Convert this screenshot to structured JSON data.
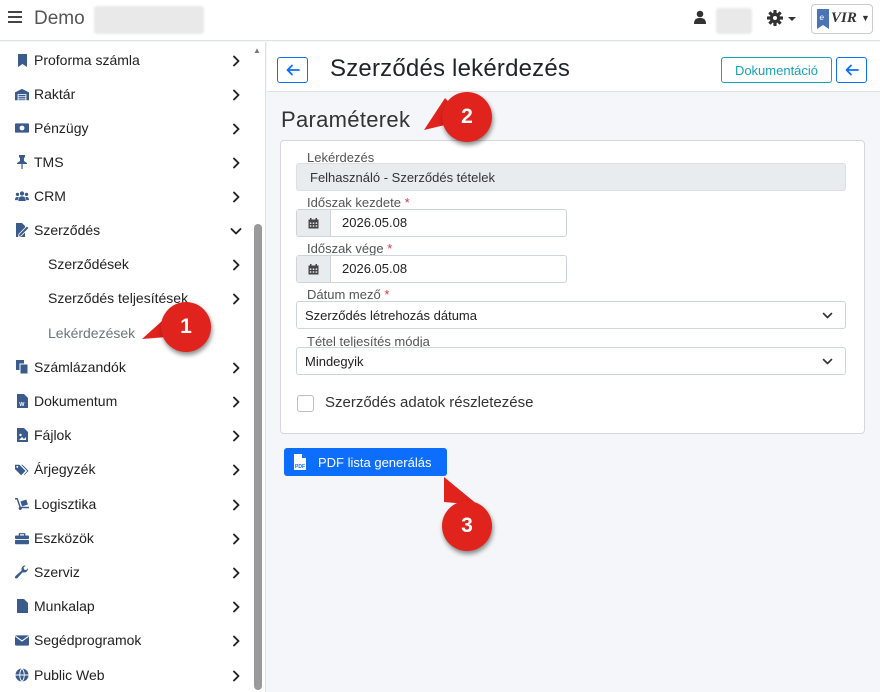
{
  "topbar": {
    "title": "Demo",
    "brand_logo_text": "VIR"
  },
  "sidebar": {
    "items": [
      {
        "label": "Proforma számla",
        "icon": "bookmark-icon"
      },
      {
        "label": "Raktár",
        "icon": "warehouse-icon"
      },
      {
        "label": "Pénzügy",
        "icon": "money-icon"
      },
      {
        "label": "TMS",
        "icon": "pin-icon"
      },
      {
        "label": "CRM",
        "icon": "users-icon"
      },
      {
        "label": "Szerződés",
        "icon": "contract-icon",
        "expanded": true
      },
      {
        "label": "Szerződések",
        "sub": true
      },
      {
        "label": "Szerződés teljesítések",
        "sub": true
      },
      {
        "label": "Lekérdezések",
        "sub": true,
        "active": true
      },
      {
        "label": "Számlázandók",
        "icon": "copy-icon"
      },
      {
        "label": "Dokumentum",
        "icon": "word-file-icon"
      },
      {
        "label": "Fájlok",
        "icon": "file-image-icon"
      },
      {
        "label": "Árjegyzék",
        "icon": "tags-icon"
      },
      {
        "label": "Logisztika",
        "icon": "dolly-icon"
      },
      {
        "label": "Eszközök",
        "icon": "toolbox-icon"
      },
      {
        "label": "Szerviz",
        "icon": "wrench-icon"
      },
      {
        "label": "Munkalap",
        "icon": "file-icon"
      },
      {
        "label": "Segédprogramok",
        "icon": "envelope-icon"
      },
      {
        "label": "Public Web",
        "icon": "globe-icon"
      }
    ]
  },
  "header": {
    "title": "Szerződés lekérdezés",
    "doc_button": "Dokumentáció"
  },
  "params": {
    "section_title": "Paraméterek",
    "query_label": "Lekérdezés",
    "query_value": "Felhasználó - Szerződés tételek",
    "start_label": "Időszak kezdete",
    "start_value": "2026.05.08",
    "end_label": "Időszak vége",
    "end_value": "2026.05.08",
    "date_field_label": "Dátum mező",
    "date_field_value": "Szerződés létrehozás dátuma",
    "mode_label": "Tétel teljesítés módja",
    "mode_value": "Mindegyik",
    "details_label": "Szerződés adatok részletezése",
    "required_mark": "*"
  },
  "actions": {
    "pdf_button": "PDF lista generálás"
  },
  "markers": [
    "1",
    "2",
    "3"
  ],
  "colors": {
    "primary": "#0d6efd",
    "info": "#17a2b8",
    "marker": "#e0231c",
    "required": "#dc3545"
  }
}
